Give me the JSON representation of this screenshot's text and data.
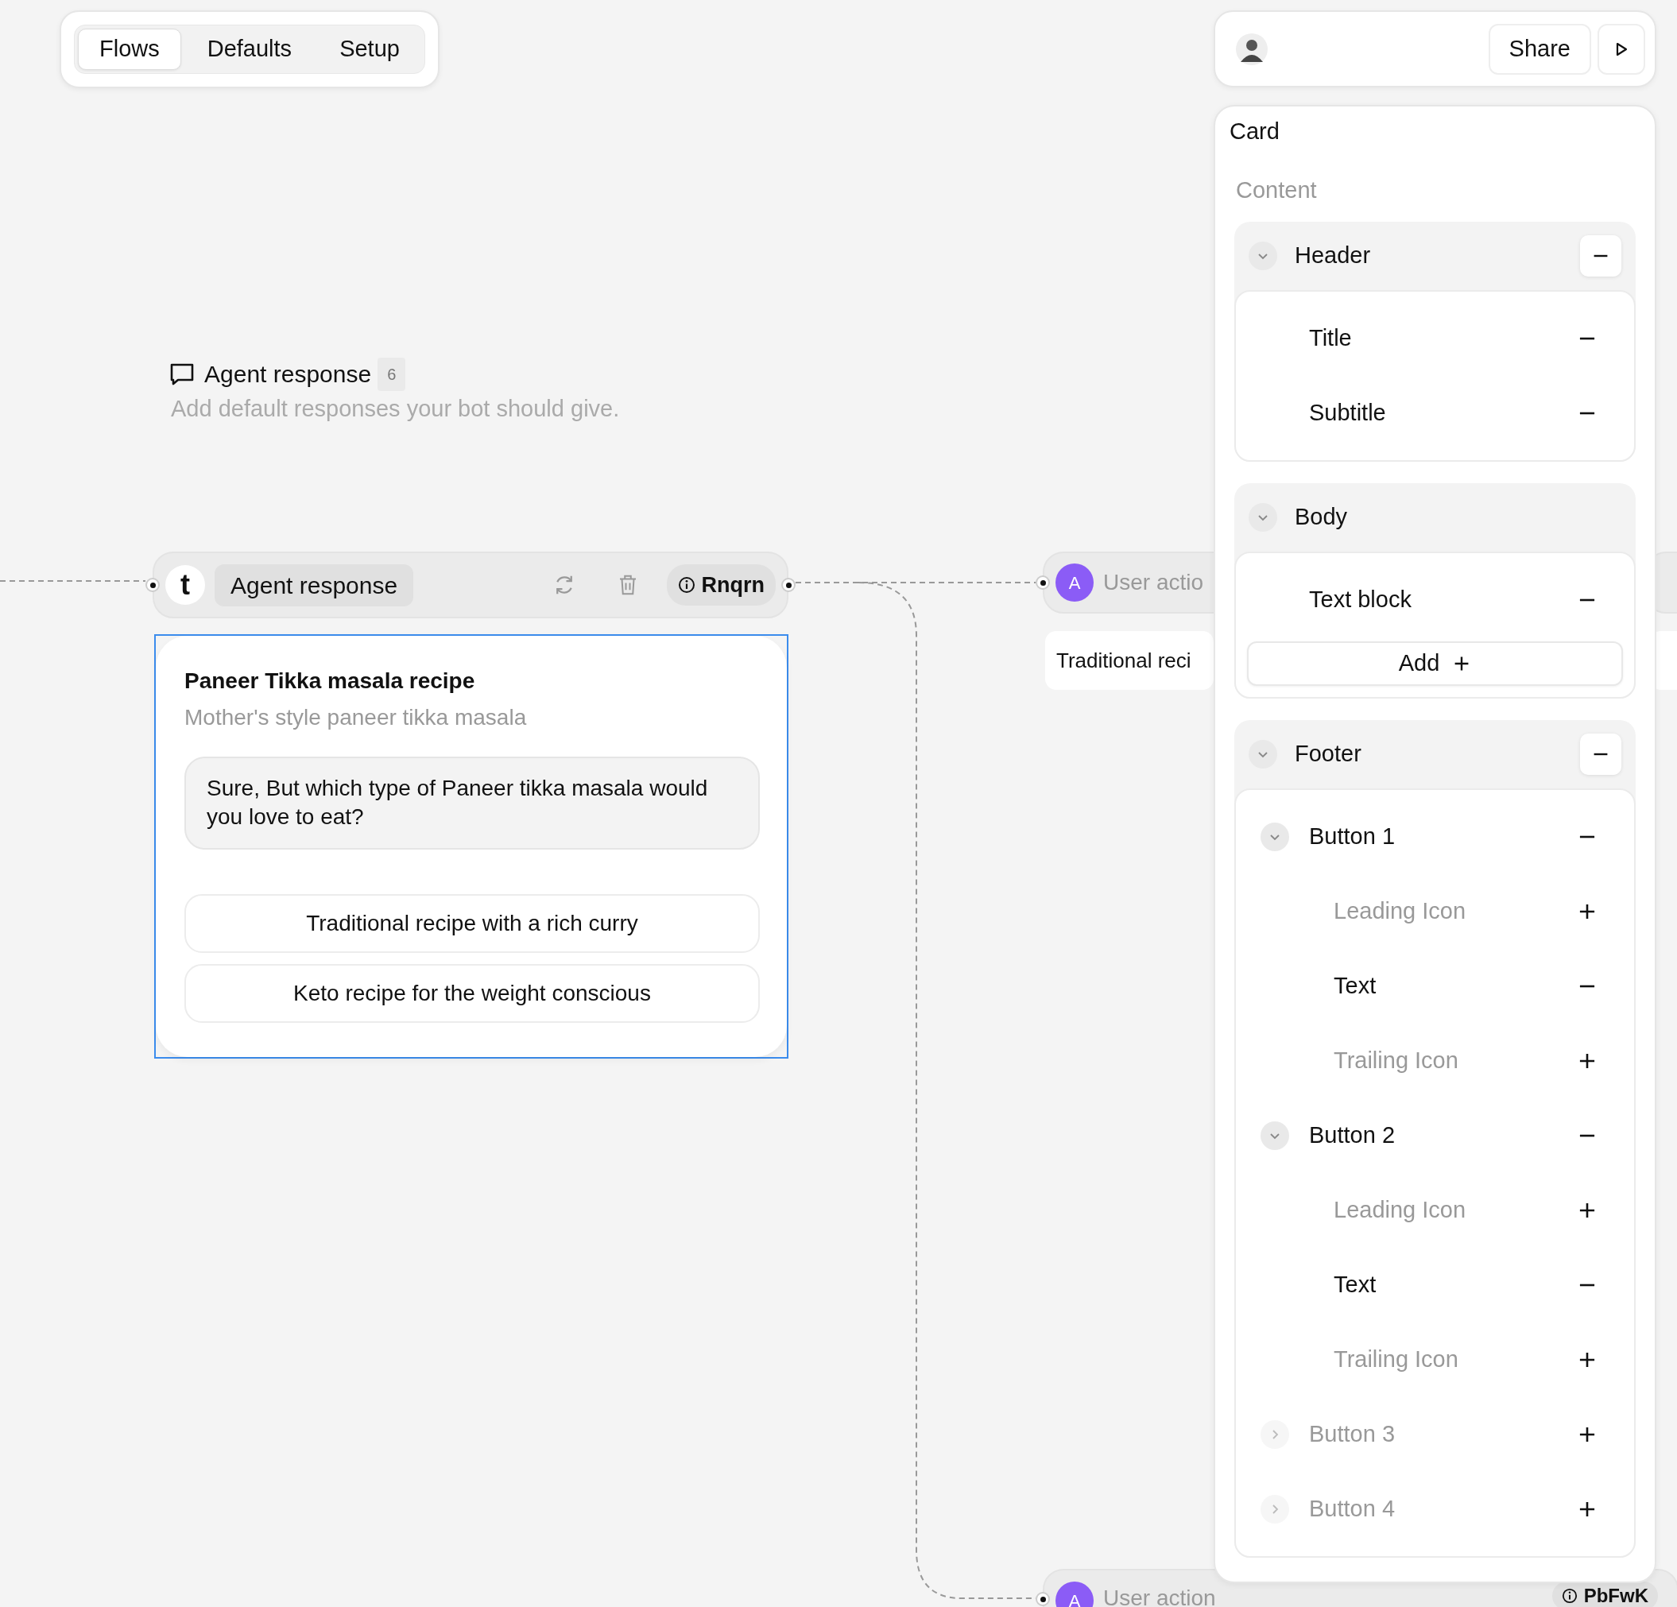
{
  "tabs": [
    {
      "label": "Flows",
      "selected": true
    },
    {
      "label": "Defaults",
      "selected": false
    },
    {
      "label": "Setup",
      "selected": false
    }
  ],
  "top_bar": {
    "share": "Share"
  },
  "section": {
    "title": "Agent response",
    "count": "6",
    "description": "Add default responses your bot should give."
  },
  "nodes": [
    {
      "kind": "agent",
      "logo": "t",
      "label": "Agent response",
      "tag": "Rnqrn",
      "selected": true,
      "card": {
        "title": "Paneer Tikka masala recipe",
        "subtitle": "Mother's style paneer tikka masala",
        "message": "Sure, But which type of Paneer tikka masala would you love to eat?",
        "options": [
          "Traditional recipe with a rich curry",
          "Keto recipe for the weight conscious"
        ]
      }
    },
    {
      "kind": "user",
      "avatar": "A",
      "label": "User actio",
      "option": "Traditional reci"
    },
    {
      "kind": "user",
      "avatar": "A",
      "label": "User action",
      "tag": "PbFwK"
    }
  ],
  "panel": {
    "title": "Card",
    "section": "Content",
    "groups": [
      {
        "label": "Header",
        "expanded": true,
        "removable": true,
        "items": [
          {
            "label": "Title",
            "included": true
          },
          {
            "label": "Subtitle",
            "included": true
          }
        ]
      },
      {
        "label": "Body",
        "expanded": true,
        "removable": false,
        "items": [
          {
            "label": "Text block",
            "included": true
          }
        ],
        "add_label": "Add"
      },
      {
        "label": "Footer",
        "expanded": true,
        "removable": true,
        "items": [
          {
            "label": "Button 1",
            "included": true,
            "expanded": true,
            "children": [
              {
                "label": "Leading Icon",
                "included": false
              },
              {
                "label": "Text",
                "included": true
              },
              {
                "label": "Trailing Icon",
                "included": false
              }
            ]
          },
          {
            "label": "Button 2",
            "included": true,
            "expanded": true,
            "children": [
              {
                "label": "Leading Icon",
                "included": false
              },
              {
                "label": "Text",
                "included": true
              },
              {
                "label": "Trailing Icon",
                "included": false
              }
            ]
          },
          {
            "label": "Button 3",
            "included": false,
            "expanded": false
          },
          {
            "label": "Button 4",
            "included": false,
            "expanded": false
          }
        ]
      }
    ]
  }
}
